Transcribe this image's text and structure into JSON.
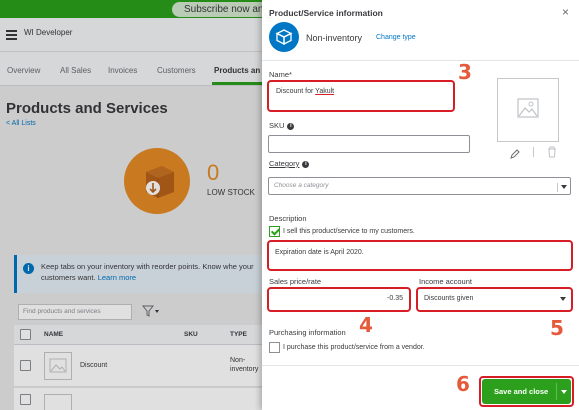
{
  "background": {
    "subscribe_banner": "Subscribe now an",
    "company_name": "WI Developer",
    "nav_tabs": [
      "Overview",
      "All Sales",
      "Invoices",
      "Customers",
      "Products an"
    ],
    "page_title": "Products and Services",
    "all_lists_link": "< All Lists",
    "stock_count": "0",
    "stock_label": "LOW STOCK",
    "tip": {
      "text": "Keep tabs on your inventory with reorder points. Know whe your customers want.",
      "link": "Learn more"
    },
    "search_placeholder": "Find products and services",
    "table": {
      "headers": [
        "NAME",
        "SKU",
        "TYPE"
      ],
      "rows": [
        {
          "name": "Discount",
          "type": "Non-inventory"
        }
      ]
    }
  },
  "drawer": {
    "title": "Product/Service information",
    "close_icon": "×",
    "item_type": "Non-inventory",
    "change_type_link": "Change type",
    "name_label": "Name*",
    "name_prefix": "Discount for ",
    "name_value_underlined": "Yakult",
    "sku_label": "SKU",
    "sku_value": "",
    "category_label": "Category",
    "category_placeholder": "Choose a category",
    "description_label": "Description",
    "sell_checkbox_label": "I sell this product/service to my customers.",
    "sell_checked": true,
    "description_value": "Expiration date is April 2020.",
    "sales_price_label": "Sales price/rate",
    "sales_price_value": "-0.35",
    "income_account_label": "Income account",
    "income_account_value": "Discounts given",
    "purchasing_label": "Purchasing information",
    "purchase_checkbox_label": "I purchase this product/service from a vendor.",
    "purchase_checked": false,
    "save_button": "Save and close"
  },
  "annotations": {
    "step_3": "3",
    "step_4": "4",
    "step_5": "5",
    "step_6": "6"
  },
  "colors": {
    "brand_green": "#2ca01c",
    "link_blue": "#0077c5",
    "highlight_red": "#d71e27",
    "badge_orange": "#e65a3c",
    "stock_orange": "#e58a25"
  },
  "icons": [
    "menu-icon",
    "box-icon",
    "close-icon",
    "info-icon",
    "image-placeholder-icon",
    "pencil-icon",
    "trash-icon",
    "chevron-down-icon",
    "filter-icon",
    "checkmark-icon"
  ]
}
